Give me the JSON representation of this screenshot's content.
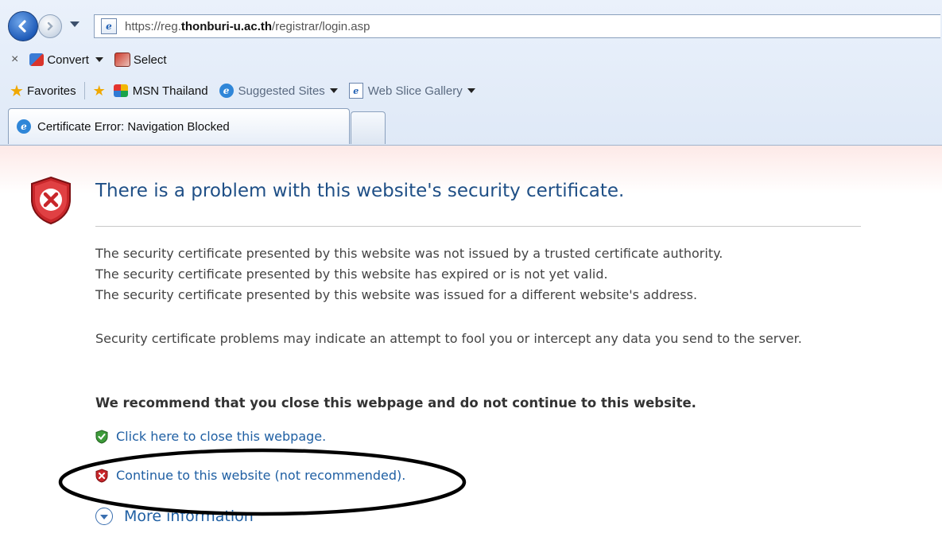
{
  "browser": {
    "address_url_prefix": "https://reg.",
    "address_url_domain": "thonburi-u.ac.th",
    "address_url_path": "/registrar/login.asp"
  },
  "toolbar": {
    "close_glyph": "×",
    "convert_label": "Convert",
    "select_label": "Select"
  },
  "favorites_bar": {
    "favorites_label": "Favorites",
    "items": [
      {
        "label": "MSN Thailand",
        "icon": "msn-icon"
      },
      {
        "label": "Suggested Sites",
        "icon": "ie-icon"
      },
      {
        "label": "Web Slice Gallery",
        "icon": "page-icon"
      }
    ]
  },
  "tabs": [
    {
      "label": "Certificate Error: Navigation Blocked",
      "active": true
    }
  ],
  "page": {
    "title": "There is a problem with this website's security certificate.",
    "reasons": [
      "The security certificate presented by this website was not issued by a trusted certificate authority.",
      "The security certificate presented by this website has expired or is not yet valid.",
      "The security certificate presented by this website was issued for a different website's address."
    ],
    "warning_paragraph": "Security certificate problems may indicate an attempt to fool you or intercept any data you send to the server.",
    "recommendation": "We recommend that you close this webpage and do not continue to this website.",
    "close_link": "Click here to close this webpage.",
    "continue_link": "Continue to this website (not recommended).",
    "more_info": "More information"
  },
  "colors": {
    "title_blue": "#1f4f86",
    "link_blue": "#1f5fa3",
    "shield_red": "#c8262a",
    "annotation_ellipse": "#000000"
  }
}
